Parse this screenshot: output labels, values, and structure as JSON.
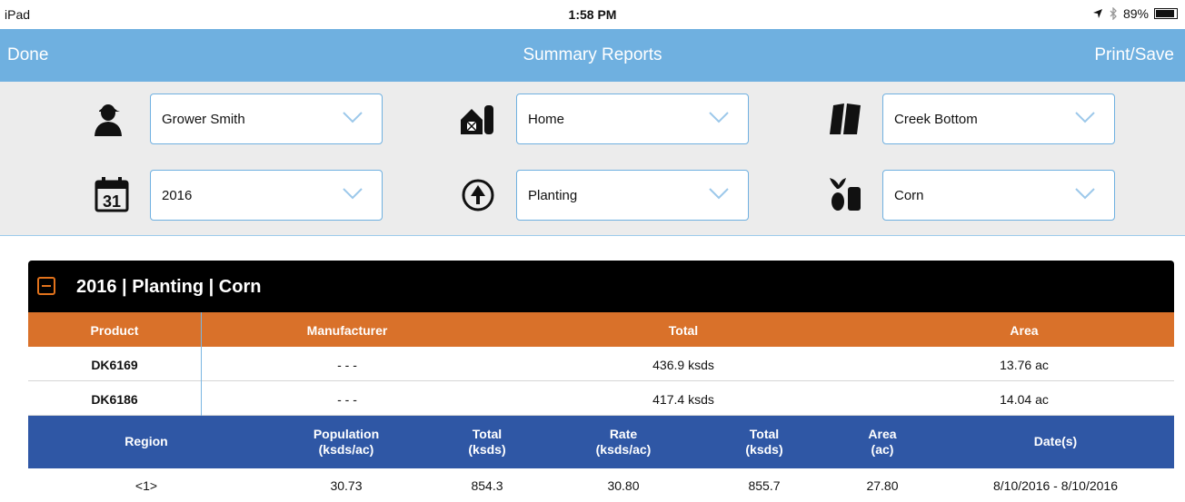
{
  "status_bar": {
    "device": "iPad",
    "time": "1:58 PM",
    "battery": "89%",
    "battery_level": 0.89,
    "icons": [
      "location-arrow-icon",
      "bluetooth-icon",
      "battery-icon"
    ]
  },
  "nav": {
    "done_label": "Done",
    "title": "Summary Reports",
    "print_label": "Print/Save"
  },
  "filters": {
    "grower": {
      "icon": "person-icon",
      "value": "Grower Smith"
    },
    "farm": {
      "icon": "barn-icon",
      "value": "Home"
    },
    "field": {
      "icon": "field-icon",
      "value": "Creek Bottom"
    },
    "year": {
      "icon": "calendar-icon",
      "icon_text": "31",
      "value": "2016"
    },
    "operation": {
      "icon": "planter-icon",
      "value": "Planting"
    },
    "crop": {
      "icon": "seed-icon",
      "value": "Corn"
    }
  },
  "report": {
    "title": "2016 | Planting | Corn",
    "product_headers": [
      "Product",
      "Manufacturer",
      "Total",
      "Area"
    ],
    "products": [
      {
        "product": "DK6169",
        "manufacturer": "- - -",
        "total": "436.9 ksds",
        "area": "13.76 ac"
      },
      {
        "product": "DK6186",
        "manufacturer": "- - -",
        "total": "417.4 ksds",
        "area": "14.04 ac"
      }
    ],
    "region_headers": {
      "region": "Region",
      "population_l1": "Population",
      "population_l2": "(ksds/ac)",
      "total1_l1": "Total",
      "total1_l2": "(ksds)",
      "rate_l1": "Rate",
      "rate_l2": "(ksds/ac)",
      "total2_l1": "Total",
      "total2_l2": "(ksds)",
      "area_l1": "Area",
      "area_l2": "(ac)",
      "dates": "Date(s)"
    },
    "regions": [
      {
        "region": "<1>",
        "population": "30.73",
        "total1": "854.3",
        "rate": "30.80",
        "total2": "855.7",
        "area": "27.80",
        "dates": "8/10/2016 - 8/10/2016"
      }
    ]
  },
  "colors": {
    "nav_blue": "#6fb0e0",
    "orange": "#d9712a",
    "navy": "#2f57a5",
    "panel_gray": "#ececec"
  }
}
